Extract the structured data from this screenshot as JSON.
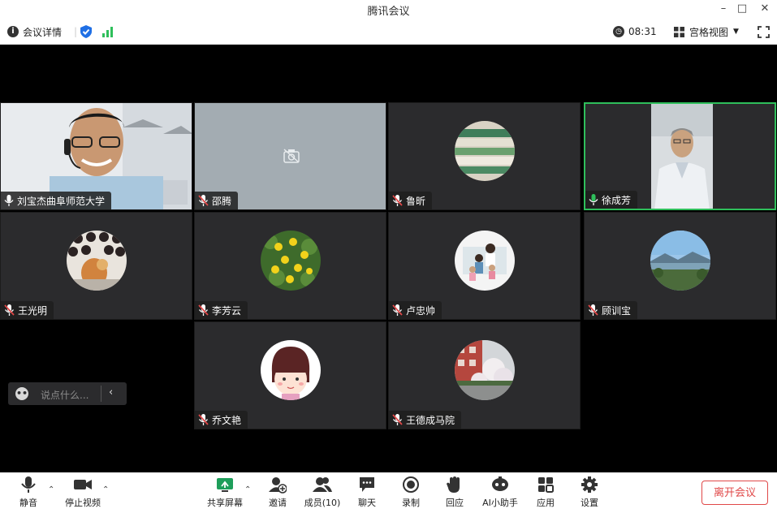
{
  "window": {
    "title": "腾讯会议"
  },
  "infobar": {
    "meeting_details": "会议详情",
    "time": "08:31",
    "view_mode": "宫格视图"
  },
  "participants": [
    {
      "name": "刘宝杰曲阜师范大学",
      "mic": "on"
    },
    {
      "name": "邵腾",
      "mic": "muted"
    },
    {
      "name": "鲁昕",
      "mic": "muted"
    },
    {
      "name": "徐成芳",
      "mic": "on"
    },
    {
      "name": "王光明",
      "mic": "muted"
    },
    {
      "name": "李芳云",
      "mic": "muted"
    },
    {
      "name": "卢忠帅",
      "mic": "muted"
    },
    {
      "name": "顾训宝",
      "mic": "muted"
    },
    {
      "name": "乔文艳",
      "mic": "muted"
    },
    {
      "name": "王德成马院",
      "mic": "muted"
    }
  ],
  "chat": {
    "placeholder": "说点什么..."
  },
  "toolbar": {
    "mute": "静音",
    "stop_video": "停止视频",
    "share_screen": "共享屏幕",
    "invite": "邀请",
    "members": "成员(10)",
    "chat": "聊天",
    "record": "录制",
    "react": "回应",
    "ai_assistant": "AI小助手",
    "apps": "应用",
    "settings": "设置",
    "leave": "离开会议"
  },
  "colors": {
    "active_speaker": "#2fbf5b",
    "leave": "#e04848",
    "security": "#1f6fe5",
    "signal": "#2fbf5b"
  }
}
